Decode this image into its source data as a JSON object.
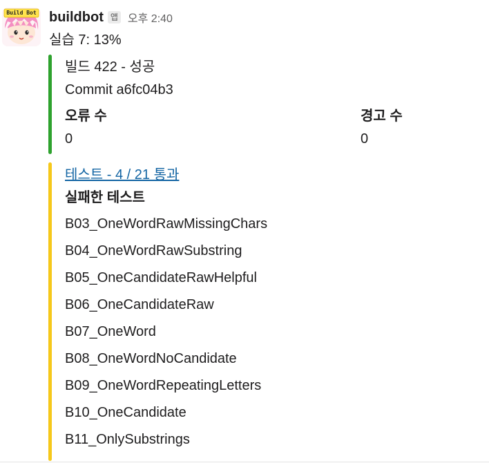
{
  "sender": {
    "name": "buildbot",
    "badge": "앱",
    "time": "오후 2:40",
    "avatar_text": "Build Bot"
  },
  "message": {
    "text": "실습 7: 13%"
  },
  "build": {
    "title": "빌드 422 - 성공",
    "commit": "Commit a6fc04b3",
    "errors_label": "오류 수",
    "errors_value": "0",
    "warnings_label": "경고 수",
    "warnings_value": "0",
    "status_color": "#2ea22e"
  },
  "tests": {
    "link_text": "테스트 - 4 / 21 통과",
    "failed_heading": "실패한 테스트",
    "status_color": "#f6c81a",
    "failed": [
      "B03_OneWordRawMissingChars",
      "B04_OneWordRawSubstring",
      "B05_OneCandidateRawHelpful",
      "B06_OneCandidateRaw",
      "B07_OneWord",
      "B08_OneWordNoCandidate",
      "B09_OneWordRepeatingLetters",
      "B10_OneCandidate",
      "B11_OnlySubstrings"
    ]
  }
}
